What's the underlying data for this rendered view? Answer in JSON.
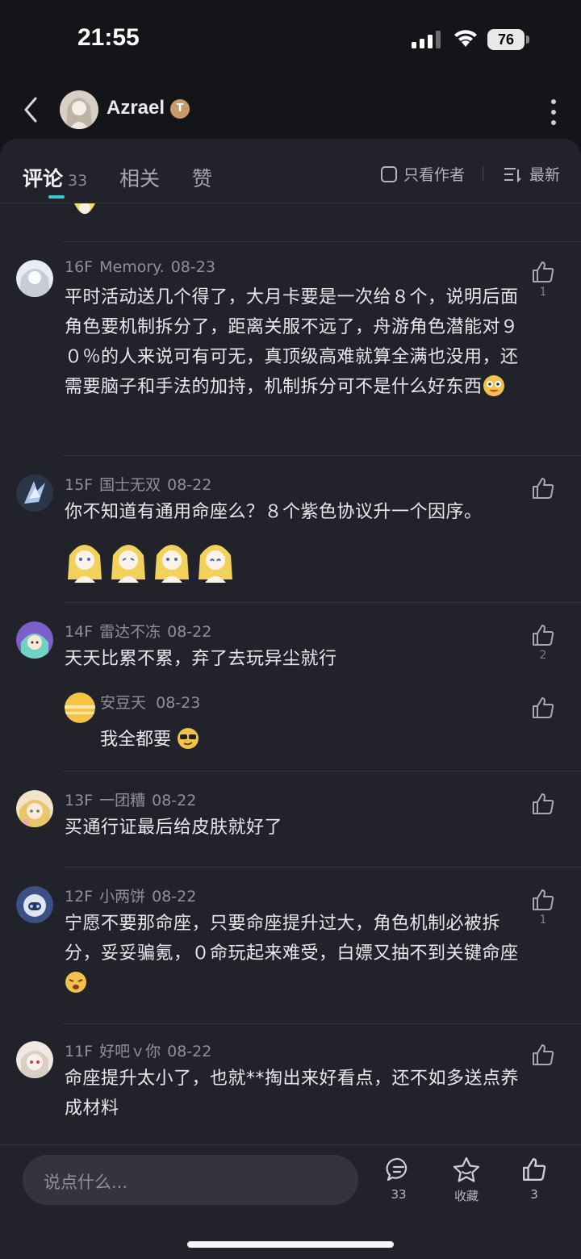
{
  "status_bar": {
    "time": "21:55",
    "battery": "76"
  },
  "header": {
    "author_name": "Azrael",
    "badge_letter": "T"
  },
  "tabs": [
    {
      "label": "评论",
      "count": "33",
      "active": true
    },
    {
      "label": "相关"
    },
    {
      "label": "赞"
    }
  ],
  "filter": {
    "only_author": "只看作者",
    "sort": "最新"
  },
  "comments": [
    {
      "floor": "16F",
      "user": "Memory.",
      "date": "08-23",
      "text": "平时活动送几个得了，大月卡要是一次给８个，说明后面角色要机制拆分了，距离关服不远了，舟游角色潜能对９０％的人来说可有可无，真顶级高难就算全满也没用，还需要脑子和手法的加持，机制拆分可不是什么好东西",
      "likes": "1"
    },
    {
      "floor": "15F",
      "user": "国士无双",
      "date": "08-22",
      "text": "你不知道有通用命座么？８个紫色协议升一个因序。",
      "likes": ""
    },
    {
      "floor": "14F",
      "user": "雷达不冻",
      "date": "08-22",
      "text": "天天比累不累，弃了去玩异尘就行",
      "likes": "2",
      "reply": {
        "user": "安豆天",
        "date": "08-23",
        "text": "我全都要"
      }
    },
    {
      "floor": "13F",
      "user": "一团糟",
      "date": "08-22",
      "text": "买通行证最后给皮肤就好了",
      "likes": ""
    },
    {
      "floor": "12F",
      "user": "小两饼",
      "date": "08-22",
      "text": "宁愿不要那命座，只要命座提升过大，角色机制必被拆分，妥妥骗氪，０命玩起来难受，白嫖又抽不到关键命座",
      "likes": "1"
    },
    {
      "floor": "11F",
      "user": "好吧ｖ你",
      "date": "08-22",
      "text": "命座提升太小了，也就**掏出来好看点，还不如多送点养成材料",
      "likes": ""
    }
  ],
  "bottom_bar": {
    "input_placeholder": "说点什么...",
    "comments_count": "33",
    "favorite_label": "收藏",
    "likes_count": "3"
  }
}
